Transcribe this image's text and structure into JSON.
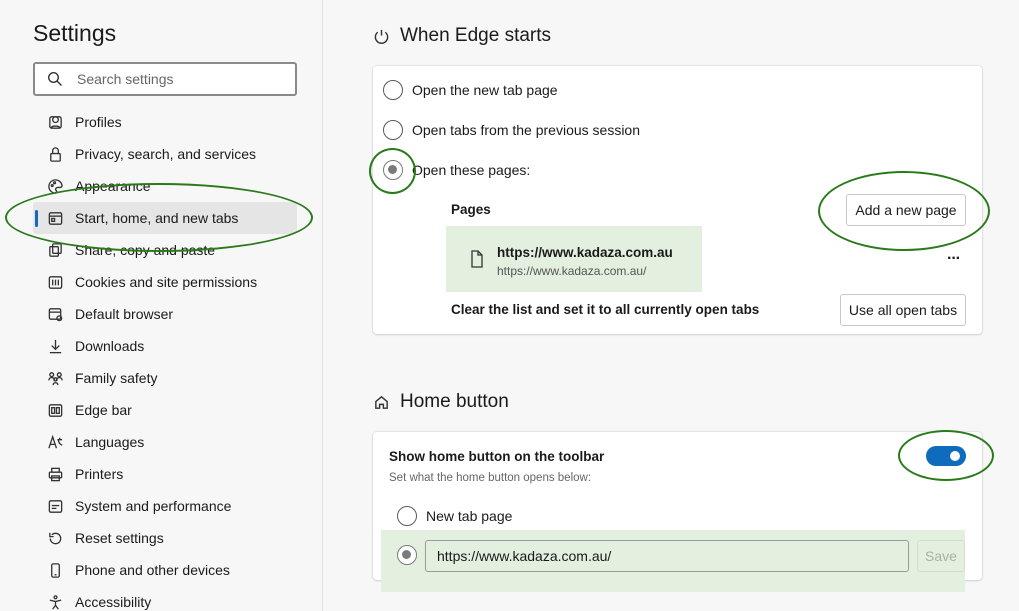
{
  "sidebar": {
    "title": "Settings",
    "search_placeholder": "Search settings",
    "items": [
      {
        "label": "Profiles",
        "icon": "profile-icon"
      },
      {
        "label": "Privacy, search, and services",
        "icon": "lock-icon"
      },
      {
        "label": "Appearance",
        "icon": "palette-icon"
      },
      {
        "label": "Start, home, and new tabs",
        "icon": "start-tabs-icon",
        "active": true
      },
      {
        "label": "Share, copy and paste",
        "icon": "share-icon"
      },
      {
        "label": "Cookies and site permissions",
        "icon": "cookies-icon"
      },
      {
        "label": "Default browser",
        "icon": "default-browser-icon"
      },
      {
        "label": "Downloads",
        "icon": "download-icon"
      },
      {
        "label": "Family safety",
        "icon": "family-icon"
      },
      {
        "label": "Edge bar",
        "icon": "edge-bar-icon"
      },
      {
        "label": "Languages",
        "icon": "languages-icon"
      },
      {
        "label": "Printers",
        "icon": "printer-icon"
      },
      {
        "label": "System and performance",
        "icon": "system-icon"
      },
      {
        "label": "Reset settings",
        "icon": "reset-icon"
      },
      {
        "label": "Phone and other devices",
        "icon": "phone-icon"
      },
      {
        "label": "Accessibility",
        "icon": "accessibility-icon"
      }
    ]
  },
  "startup": {
    "title": "When Edge starts",
    "options": [
      {
        "label": "Open the new tab page",
        "checked": false
      },
      {
        "label": "Open tabs from the previous session",
        "checked": false
      },
      {
        "label": "Open these pages:",
        "checked": true
      }
    ],
    "pages_label": "Pages",
    "add_page_label": "Add a new page",
    "page_entry": {
      "title": "https://www.kadaza.com.au",
      "url": "https://www.kadaza.com.au/"
    },
    "more_label": "···",
    "clear_label": "Clear the list and set it to all currently open tabs",
    "use_all_label": "Use all open tabs"
  },
  "home": {
    "title": "Home button",
    "show_label": "Show home button on the toolbar",
    "show_sub": "Set what the home button opens below:",
    "toggle_on": true,
    "option_new_tab": "New tab page",
    "url_value": "https://www.kadaza.com.au/",
    "save_label": "Save"
  },
  "colors": {
    "accent": "#0f6cbd",
    "highlight": "#e3efdf",
    "annotation": "#2a7a1a"
  }
}
